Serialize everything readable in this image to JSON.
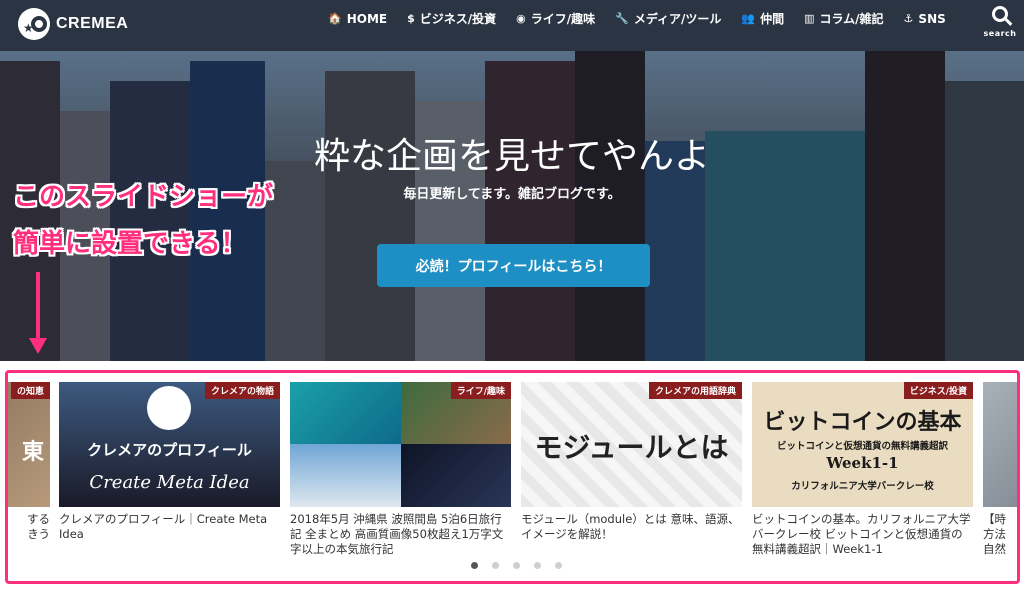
{
  "header": {
    "logo_text": "CREMEA",
    "nav": [
      {
        "icon": "home-icon",
        "glyph": "🏠",
        "label": "HOME"
      },
      {
        "icon": "dollar-icon",
        "glyph": "$",
        "label": "ビジネス/投資"
      },
      {
        "icon": "globe-icon",
        "glyph": "◉",
        "label": "ライフ/趣味"
      },
      {
        "icon": "wrench-icon",
        "glyph": "🔧",
        "label": "メディア/ツール"
      },
      {
        "icon": "users-icon",
        "glyph": "👥",
        "label": "仲間"
      },
      {
        "icon": "columns-icon",
        "glyph": "▥",
        "label": "コラム/雑記"
      },
      {
        "icon": "anchor-icon",
        "glyph": "⚓",
        "label": "SNS"
      }
    ],
    "search_label": "search"
  },
  "hero": {
    "title": "粋な企画を見せてやんよ",
    "subtitle": "毎日更新してます。雑記ブログです。",
    "button_label": "必読！プロフィールはこちら！"
  },
  "annotation": {
    "line1": "このスライドショーが",
    "line2": "簡単に設置できる！"
  },
  "slider": {
    "cards": [
      {
        "category": "の知恵",
        "title": "する\nきう",
        "thumb_text": "東"
      },
      {
        "category": "クレメアの物語",
        "title": "クレメアのプロフィール｜Create Meta Idea",
        "thumb_text": "クレメアのプロフィール",
        "thumb_sub": "Create Meta Idea"
      },
      {
        "category": "ライフ/趣味",
        "title": "2018年5月 沖縄県 波照間島 5泊6日旅行記 全まとめ 高画質画像50枚超え1万字文字以上の本気旅行記"
      },
      {
        "category": "クレメアの用語辞典",
        "title": "モジュール（module）とは 意味、語源、イメージを解説！",
        "thumb_text": "モジュールとは"
      },
      {
        "category": "ビジネス/投資",
        "title": "ビットコインの基本。カリフォルニア大学バークレー校 ビットコインと仮想通貨の無料講義超訳｜Week1-1",
        "thumb_text": "ビットコインの基本",
        "thumb_sub": "ビットコインと仮想通貨の無料講義超訳",
        "thumb_week": "Week1-1",
        "thumb_univ": "カリフォルニア大学バークレー校"
      },
      {
        "title": "【時\n方法\n自然"
      }
    ],
    "dots": 5,
    "active_dot": 0
  },
  "colors": {
    "header_bg": "#2b3442",
    "button_blue": "#1d8fc4",
    "highlight_pink": "#ff2f7e",
    "category_badge": "#8a1d1d"
  }
}
